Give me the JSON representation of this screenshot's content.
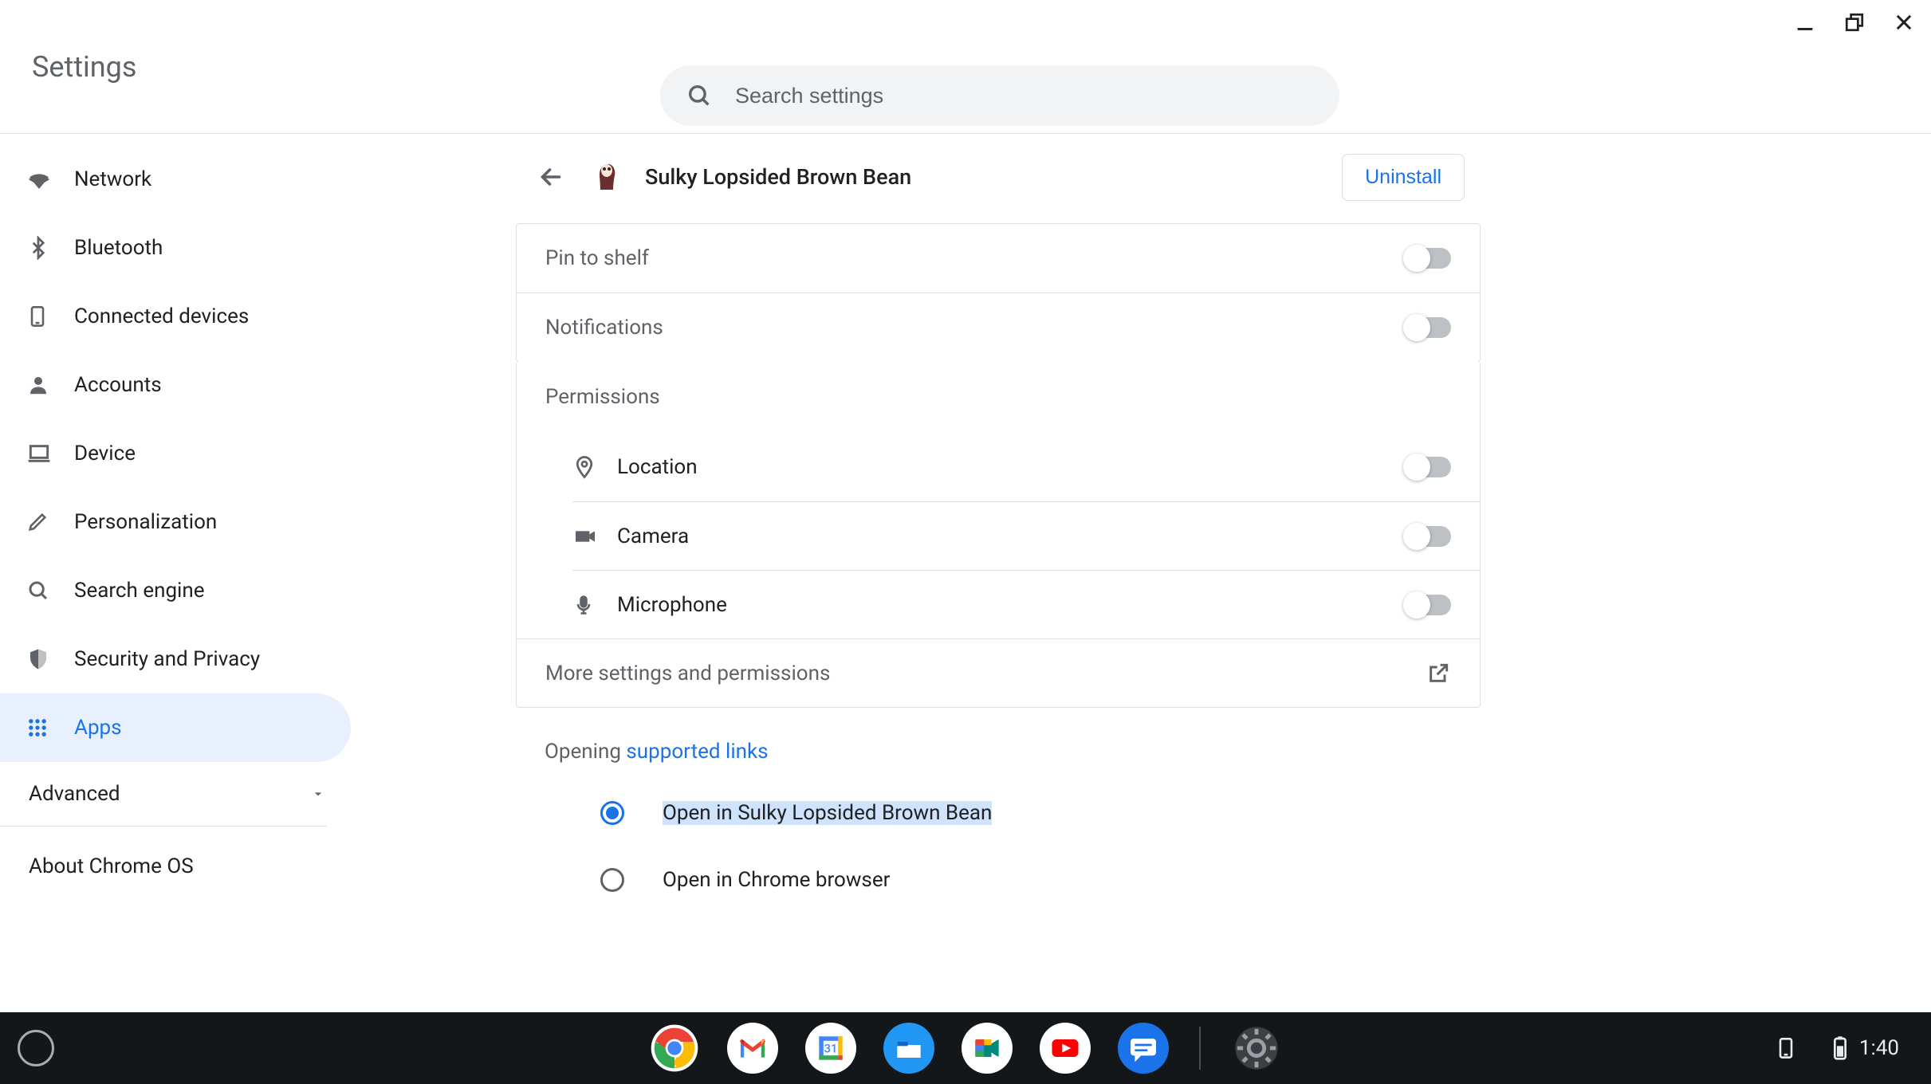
{
  "header": {
    "title": "Settings",
    "search_placeholder": "Search settings"
  },
  "sidebar": {
    "items": [
      {
        "label": "Network"
      },
      {
        "label": "Bluetooth"
      },
      {
        "label": "Connected devices"
      },
      {
        "label": "Accounts"
      },
      {
        "label": "Device"
      },
      {
        "label": "Personalization"
      },
      {
        "label": "Search engine"
      },
      {
        "label": "Security and Privacy"
      },
      {
        "label": "Apps"
      }
    ],
    "advanced": "Advanced",
    "about": "About Chrome OS"
  },
  "panel": {
    "title": "Sulky Lopsided Brown Bean",
    "uninstall": "Uninstall",
    "pin_to_shelf": "Pin to shelf",
    "notifications": "Notifications",
    "permissions_title": "Permissions",
    "permissions": {
      "location": "Location",
      "camera": "Camera",
      "microphone": "Microphone"
    },
    "more_settings": "More settings and permissions",
    "opening_prefix": "Opening ",
    "opening_link": "supported links",
    "radio_open_in_app": "Open in Sulky Lopsided Brown Bean",
    "radio_open_in_browser": "Open in Chrome browser"
  },
  "shelf": {
    "apps": [
      "chrome",
      "gmail",
      "calendar",
      "files",
      "meet",
      "youtube",
      "messages",
      "settings"
    ],
    "time": "1:40"
  }
}
